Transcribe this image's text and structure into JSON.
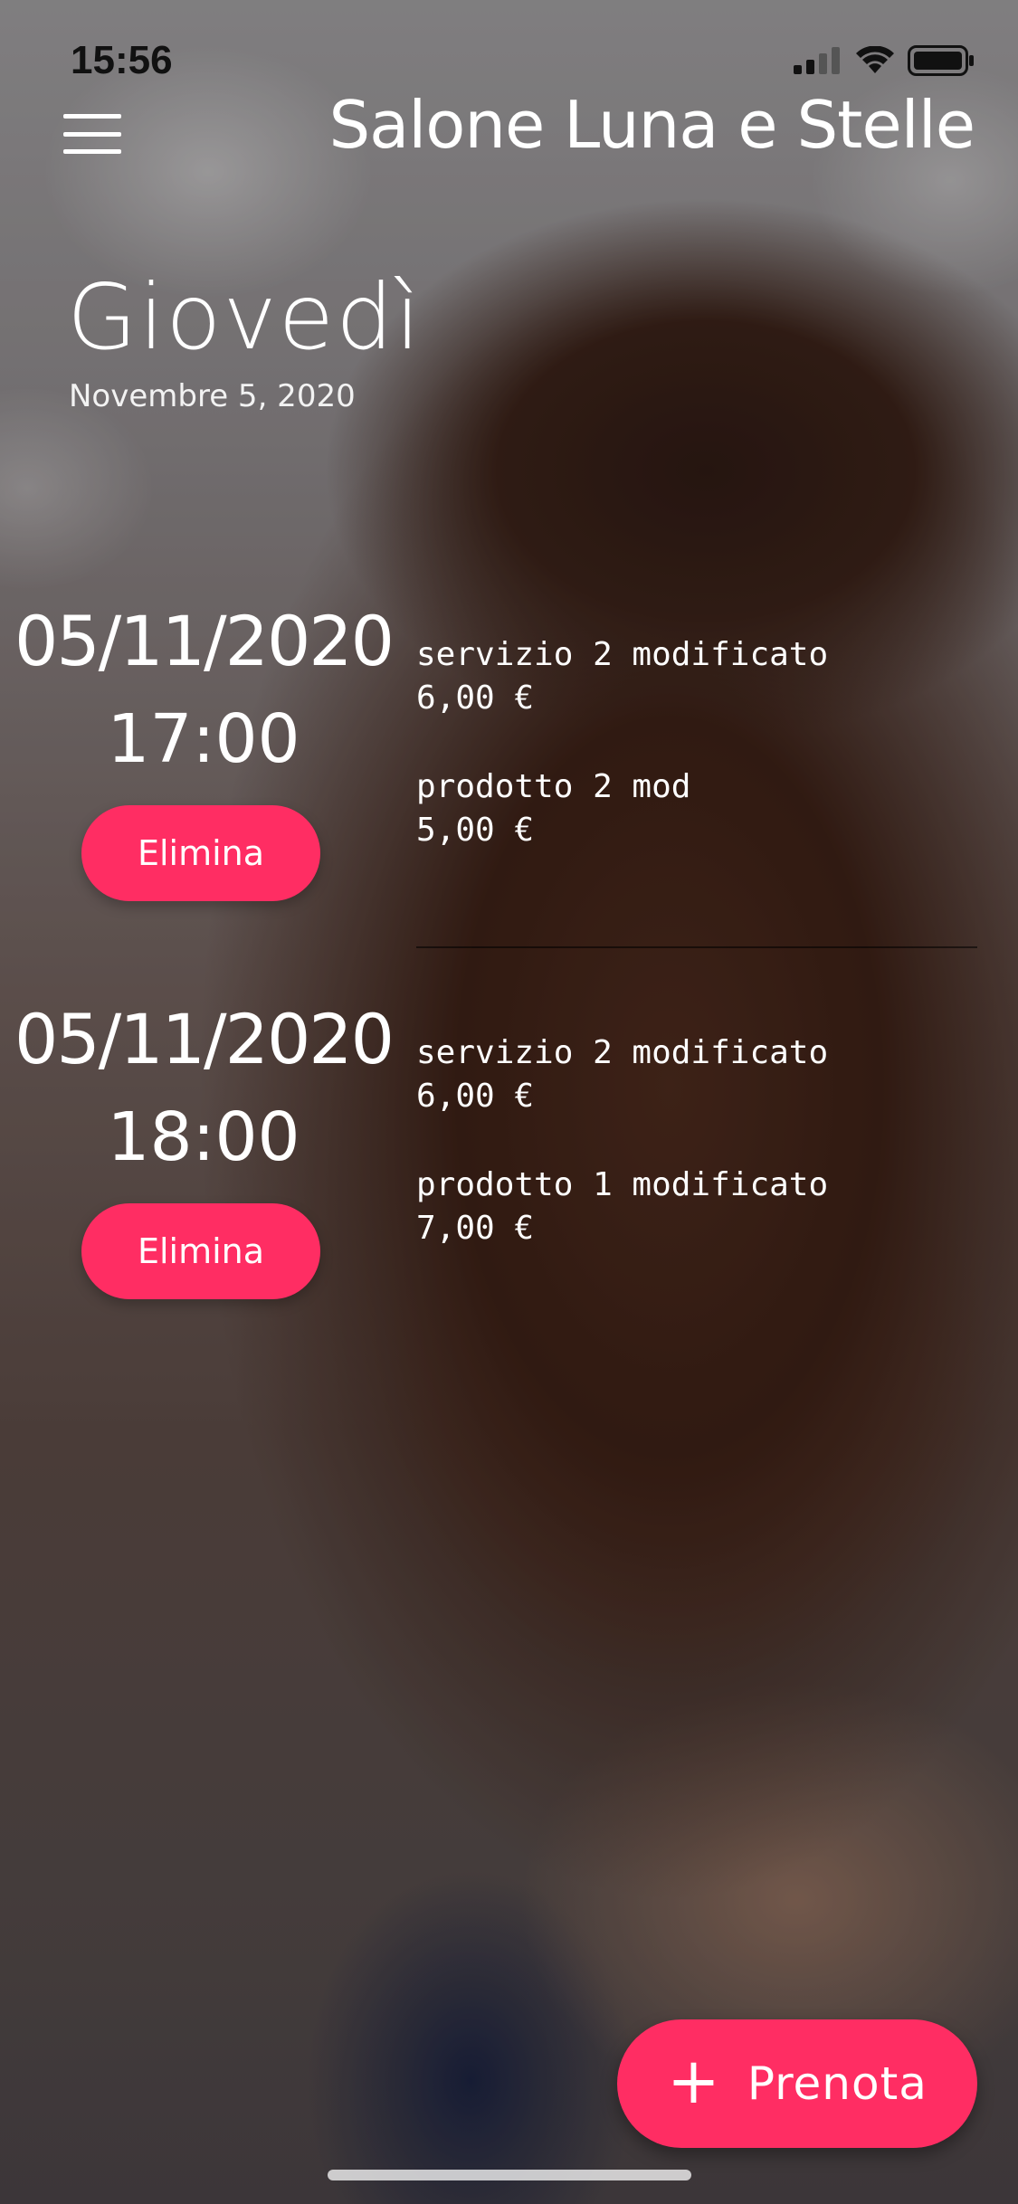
{
  "status_bar": {
    "time": "15:56",
    "icons": [
      "signal-icon",
      "wifi-icon",
      "battery-icon"
    ]
  },
  "header": {
    "menu_icon": "hamburger-menu-icon",
    "title": "Salone Luna e Stelle"
  },
  "day": {
    "weekday": "Giovedì",
    "date": "Novembre  5, 2020"
  },
  "appointments": [
    {
      "date": "05/11/2020",
      "time": "17:00",
      "delete_label": "Elimina",
      "items": [
        {
          "name": "servizio 2 modificato",
          "price": "6,00 €"
        },
        {
          "name": "prodotto 2 mod",
          "price": "5,00 €"
        }
      ]
    },
    {
      "date": "05/11/2020",
      "time": "18:00",
      "delete_label": "Elimina",
      "items": [
        {
          "name": "servizio 2 modificato",
          "price": "6,00 €"
        },
        {
          "name": "prodotto 1 modificato",
          "price": "7,00 €"
        }
      ]
    }
  ],
  "book_button": {
    "icon": "plus-icon",
    "label": "Prenota"
  },
  "colors": {
    "accent": "#ff2d63",
    "text": "#ffffff"
  }
}
